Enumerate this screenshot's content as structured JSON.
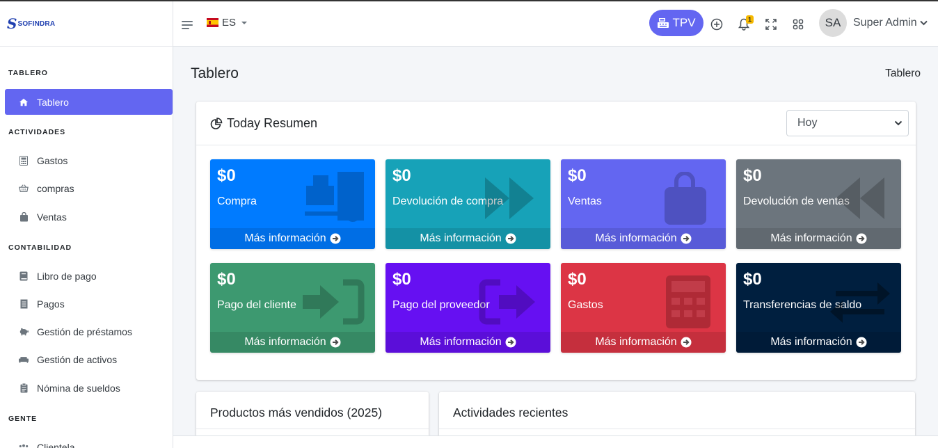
{
  "brand": {
    "logo_letter": "S",
    "logo_text": "SOFINDRA"
  },
  "sidebar": {
    "sections": [
      {
        "header": "TABLERO"
      },
      {
        "header": "ACTIVIDADES"
      },
      {
        "header": "CONTABILIDAD"
      },
      {
        "header": "GENTE"
      }
    ],
    "items": [
      {
        "label": "Tablero",
        "icon": "home-icon",
        "active": true
      },
      {
        "label": "Gastos",
        "icon": "calculator-icon"
      },
      {
        "label": "compras",
        "icon": "basket-icon"
      },
      {
        "label": "Ventas",
        "icon": "shopping-bag-icon"
      },
      {
        "label": "Libro de pago",
        "icon": "book-icon"
      },
      {
        "label": "Pagos",
        "icon": "receipt-icon"
      },
      {
        "label": "Gestión de préstamos",
        "icon": "piggy-bank-icon"
      },
      {
        "label": "Gestión de activos",
        "icon": "couch-icon"
      },
      {
        "label": "Nómina de sueldos",
        "icon": "clipboard-icon"
      },
      {
        "label": "Clientela",
        "icon": "users-icon"
      }
    ]
  },
  "navbar": {
    "language": "ES",
    "tpv_label": "TPV",
    "notification_count": "1",
    "avatar_initials": "SA",
    "user_name": "Super Admin"
  },
  "page": {
    "title": "Tablero",
    "breadcrumb": "Tablero"
  },
  "summary": {
    "title": "Today Resumen",
    "period_selected": "Hoy",
    "more_info_label": "Más información",
    "boxes": [
      {
        "amount": "$0",
        "label": "Compra",
        "color": "#007bff",
        "icon": "dolly-icon"
      },
      {
        "amount": "$0",
        "label": "Devolución de compra",
        "color": "#17a2b8",
        "icon": "forward-icon"
      },
      {
        "amount": "$0",
        "label": "Ventas",
        "color": "#6366f1",
        "icon": "shopping-bag-icon"
      },
      {
        "amount": "$0",
        "label": "Devolución de ventas",
        "color": "#6c757d",
        "icon": "backward-icon"
      },
      {
        "amount": "$0",
        "label": "Pago del cliente",
        "color": "#3d9970",
        "icon": "sign-in-icon"
      },
      {
        "amount": "$0",
        "label": "Pago del proveedor",
        "color": "#6610f2",
        "icon": "sign-out-icon"
      },
      {
        "amount": "$0",
        "label": "Gastos",
        "color": "#dc3545",
        "icon": "calculator-icon"
      },
      {
        "amount": "$0",
        "label": "Transferencias de saldo",
        "color": "#001f3f",
        "icon": "exchange-icon"
      }
    ]
  },
  "panels": {
    "top_products_title": "Productos más vendidos (2025)",
    "recent_activity_title": "Actividades recientes"
  }
}
